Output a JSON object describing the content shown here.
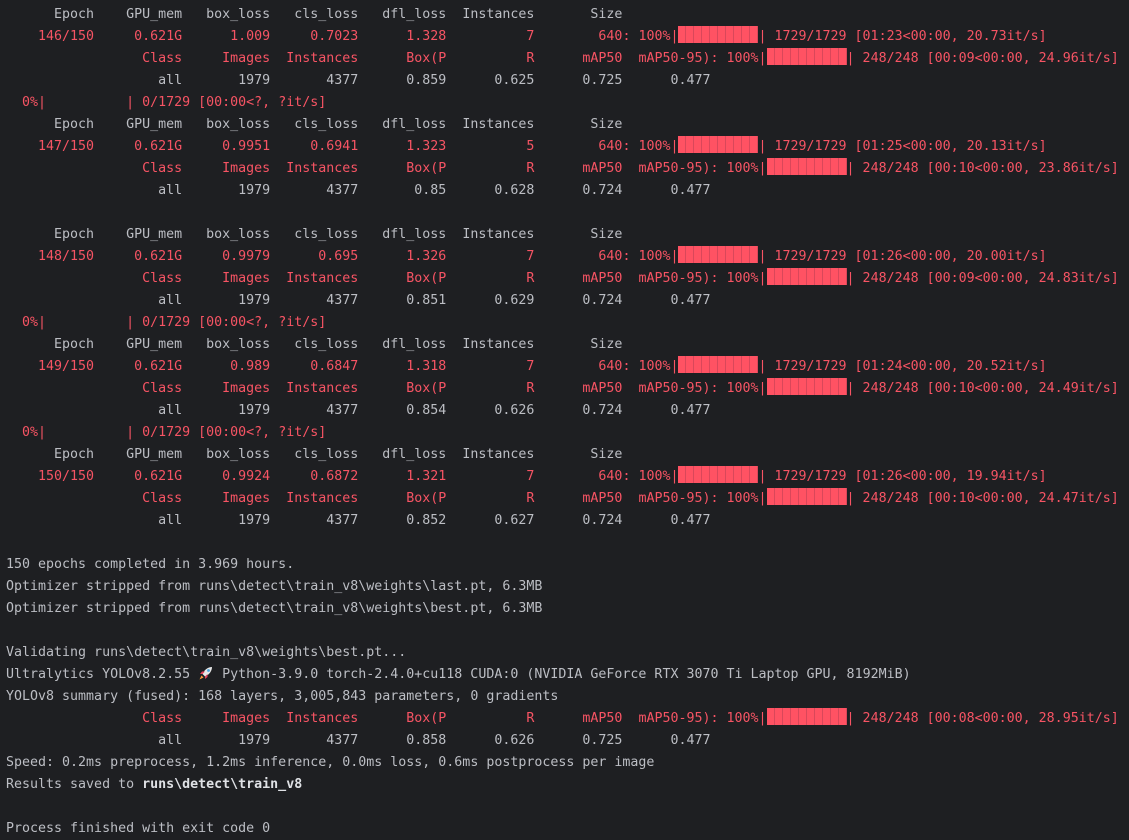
{
  "colors": {
    "background": "#1e1f22",
    "text": "#bcbec4",
    "error_red": "#f75464",
    "bar": "#ff5263"
  },
  "train_header": [
    "Epoch",
    "GPU_mem",
    "box_loss",
    "cls_loss",
    "dfl_loss",
    "Instances",
    "Size"
  ],
  "val_header": [
    "Class",
    "Images",
    "Instances",
    "Box(P",
    "R",
    "mAP50",
    "mAP50-95)"
  ],
  "idle_progress": {
    "percent": "0%",
    "text": "0/1729 [00:00<?, ?it/s]"
  },
  "epochs": [
    {
      "values": [
        "146/150",
        "0.621G",
        "1.009",
        "0.7023",
        "1.328",
        "7",
        "640"
      ],
      "train_progress": {
        "percent": "100%",
        "fraction": 1.0,
        "text": "1729/1729 [01:23<00:00, 20.73it/s]"
      },
      "val_progress": {
        "percent": "100%",
        "fraction": 1.0,
        "text": "248/248 [00:09<00:00, 24.96it/s]"
      },
      "metrics": [
        "all",
        "1979",
        "4377",
        "0.859",
        "0.625",
        "0.725",
        "0.477"
      ],
      "after": "idle"
    },
    {
      "values": [
        "147/150",
        "0.621G",
        "0.9951",
        "0.6941",
        "1.323",
        "5",
        "640"
      ],
      "train_progress": {
        "percent": "100%",
        "fraction": 1.0,
        "text": "1729/1729 [01:25<00:00, 20.13it/s]"
      },
      "val_progress": {
        "percent": "100%",
        "fraction": 1.0,
        "text": "248/248 [00:10<00:00, 23.86it/s]"
      },
      "metrics": [
        "all",
        "1979",
        "4377",
        "0.85",
        "0.628",
        "0.724",
        "0.477"
      ],
      "after": "blank"
    },
    {
      "values": [
        "148/150",
        "0.621G",
        "0.9979",
        "0.695",
        "1.326",
        "7",
        "640"
      ],
      "train_progress": {
        "percent": "100%",
        "fraction": 1.0,
        "text": "1729/1729 [01:26<00:00, 20.00it/s]"
      },
      "val_progress": {
        "percent": "100%",
        "fraction": 1.0,
        "text": "248/248 [00:09<00:00, 24.83it/s]"
      },
      "metrics": [
        "all",
        "1979",
        "4377",
        "0.851",
        "0.629",
        "0.724",
        "0.477"
      ],
      "after": "idle"
    },
    {
      "values": [
        "149/150",
        "0.621G",
        "0.989",
        "0.6847",
        "1.318",
        "7",
        "640"
      ],
      "train_progress": {
        "percent": "100%",
        "fraction": 1.0,
        "text": "1729/1729 [01:24<00:00, 20.52it/s]"
      },
      "val_progress": {
        "percent": "100%",
        "fraction": 1.0,
        "text": "248/248 [00:10<00:00, 24.49it/s]"
      },
      "metrics": [
        "all",
        "1979",
        "4377",
        "0.854",
        "0.626",
        "0.724",
        "0.477"
      ],
      "after": "idle"
    },
    {
      "values": [
        "150/150",
        "0.621G",
        "0.9924",
        "0.6872",
        "1.321",
        "7",
        "640"
      ],
      "train_progress": {
        "percent": "100%",
        "fraction": 1.0,
        "text": "1729/1729 [01:26<00:00, 19.94it/s]"
      },
      "val_progress": {
        "percent": "100%",
        "fraction": 1.0,
        "text": "248/248 [00:10<00:00, 24.47it/s]"
      },
      "metrics": [
        "all",
        "1979",
        "4377",
        "0.852",
        "0.627",
        "0.724",
        "0.477"
      ],
      "after": "blank"
    }
  ],
  "summary": {
    "completed": "150 epochs completed in 3.969 hours.",
    "optimizer_last": "Optimizer stripped from runs\\detect\\train_v8\\weights\\last.pt, 6.3MB",
    "optimizer_best": "Optimizer stripped from runs\\detect\\train_v8\\weights\\best.pt, 6.3MB",
    "validating": "Validating runs\\detect\\train_v8\\weights\\best.pt...",
    "ultralytics_before": "Ultralytics YOLOv8.2.55 ",
    "ultralytics_after": "Python-3.9.0 torch-2.4.0+cu118 CUDA:0 (NVIDIA GeForce RTX 3070 Ti Laptop GPU, 8192MiB)",
    "model_summary": "YOLOv8 summary (fused): 168 layers, 3,005,843 parameters, 0 gradients",
    "final_val_progress": {
      "percent": "100%",
      "fraction": 1.0,
      "text": "248/248 [00:08<00:00, 28.95it/s]"
    },
    "final_metrics": [
      "all",
      "1979",
      "4377",
      "0.858",
      "0.626",
      "0.725",
      "0.477"
    ],
    "speed": "Speed: 0.2ms preprocess, 1.2ms inference, 0.0ms loss, 0.6ms postprocess per image",
    "results_prefix": "Results saved to ",
    "results_path": "runs\\detect\\train_v8",
    "process_finished": "Process finished with exit code 0"
  }
}
